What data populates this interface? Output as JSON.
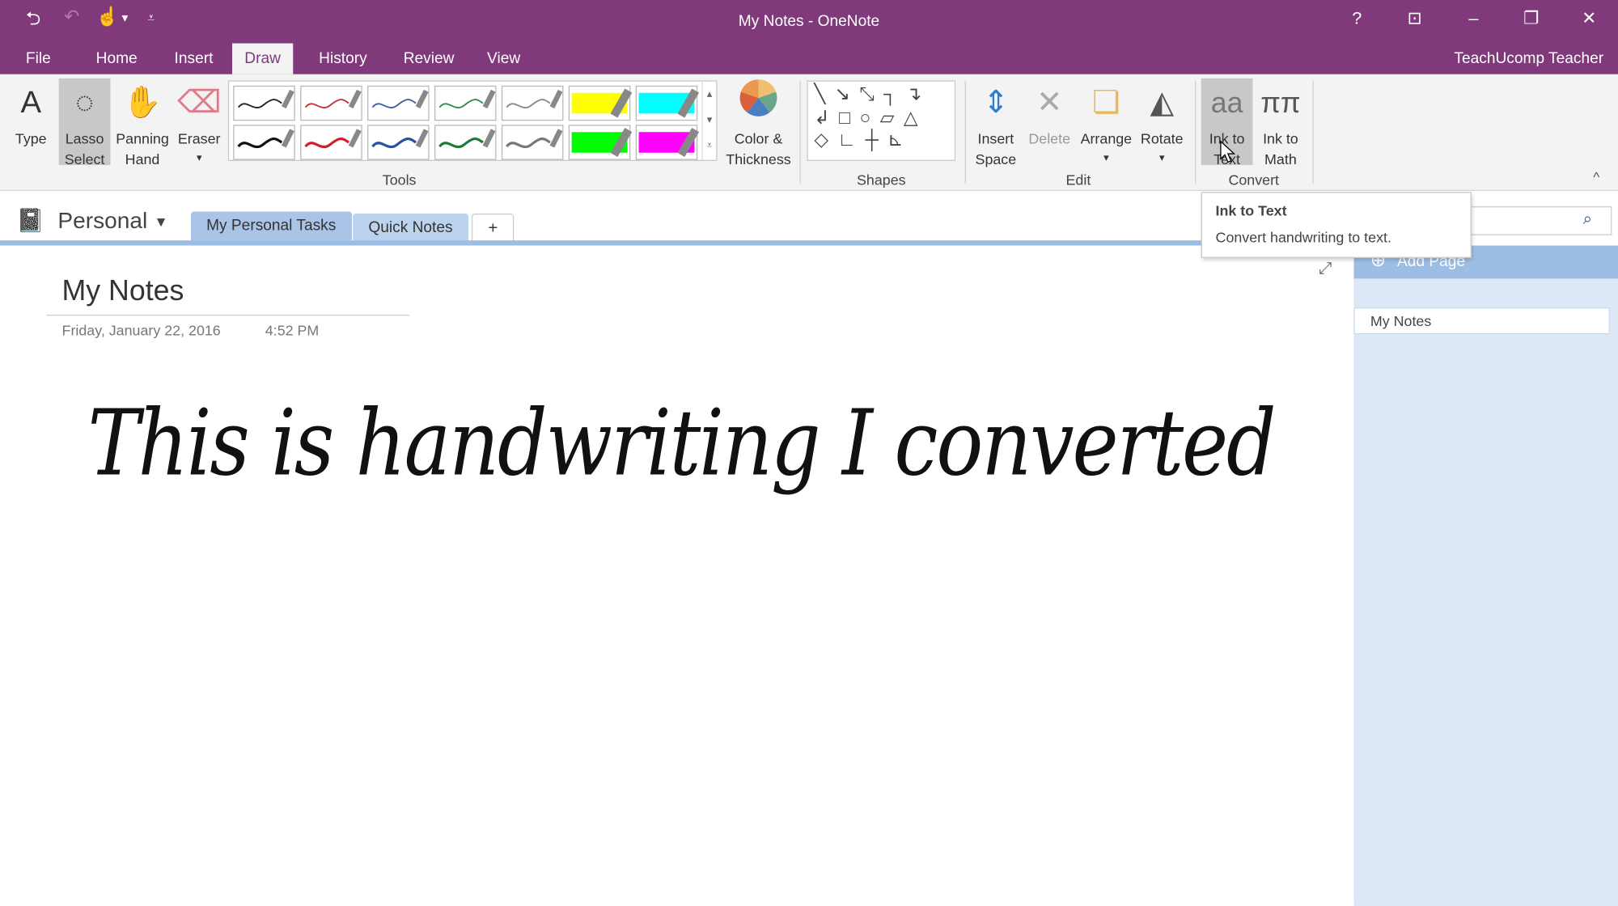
{
  "window": {
    "title": "My Notes - OneNote",
    "user": "TeachUcomp Teacher",
    "help": "?",
    "minimize": "–",
    "restore": "❐",
    "close": "✕",
    "ribbon_display": "⊡"
  },
  "quick_access": {
    "back": "⮌",
    "undo": "↶",
    "touch": "☝",
    "more": "▾",
    "customize": "⩡"
  },
  "menu_tabs": [
    "File",
    "Home",
    "Insert",
    "Draw",
    "History",
    "Review",
    "View"
  ],
  "active_tab": "Draw",
  "ribbon": {
    "tools": [
      {
        "label1": "Type",
        "label2": "",
        "icon": "A"
      },
      {
        "label1": "Lasso",
        "label2": "Select",
        "icon": "◌"
      },
      {
        "label1": "Panning",
        "label2": "Hand",
        "icon": "✋"
      },
      {
        "label1": "Eraser",
        "label2": "▾",
        "icon": "⌫"
      }
    ],
    "pens": {
      "row1": [
        "#222222",
        "#c8303a",
        "#3a62a8",
        "#2e8b57",
        "#888888",
        "#ffff00",
        "#00ffff"
      ],
      "row2": [
        "#111111",
        "#d0202a",
        "#2850a0",
        "#1f7a3a",
        "#777777",
        "#00ff00",
        "#ff00ff"
      ]
    },
    "color_thickness": {
      "label1": "Color &",
      "label2": "Thickness"
    },
    "tools_group": "Tools",
    "shapes_rows": [
      "╲ ↘ ⤡ ┐ ↴",
      "↲ □ ○ ▱ △",
      "◇ ∟ ┼ ⊾"
    ],
    "shapes_group": "Shapes",
    "edit": [
      {
        "label1": "Insert",
        "label2": "Space",
        "icon": "⇕"
      },
      {
        "label1": "Delete",
        "label2": "",
        "icon": "✕"
      },
      {
        "label1": "Arrange",
        "label2": "▾",
        "icon": "❏"
      },
      {
        "label1": "Rotate",
        "label2": "▾",
        "icon": "◭"
      }
    ],
    "edit_group": "Edit",
    "convert": [
      {
        "label1": "Ink to",
        "label2": "Text",
        "icon": "aa"
      },
      {
        "label1": "Ink to",
        "label2": "Math",
        "icon": "ππ"
      }
    ],
    "convert_group": "Convert",
    "collapse": "^"
  },
  "notebook": {
    "name": "Personal",
    "dropdown": "▾"
  },
  "section_tabs": [
    "My Personal Tasks",
    "Quick Notes"
  ],
  "add_section": "+",
  "page": {
    "title": "My Notes",
    "date": "Friday, January 22, 2016",
    "time": "4:52 PM",
    "ink": "This is handwriting I converted",
    "expand": "⤢"
  },
  "pane": {
    "add_page": "Add Page",
    "pages": [
      "My Notes"
    ],
    "search_icon": "⌕"
  },
  "tooltip": {
    "title": "Ink to Text",
    "body": "Convert handwriting to text."
  }
}
